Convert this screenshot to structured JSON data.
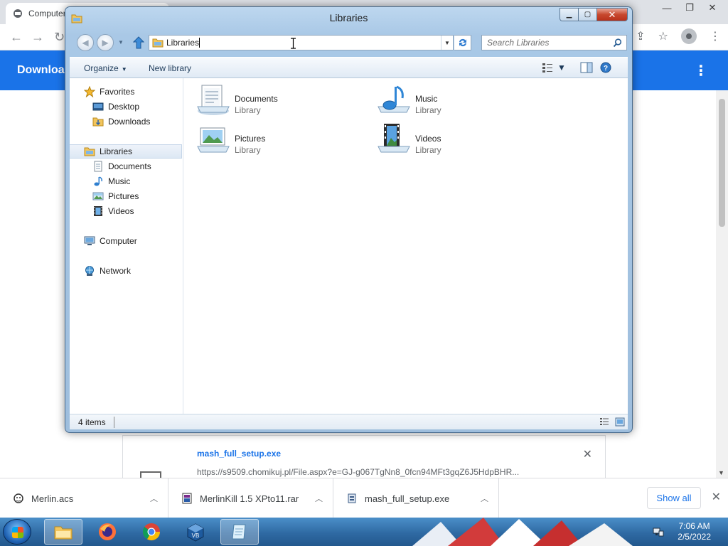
{
  "chrome": {
    "tab_title": "Computer",
    "header_title": "Downloads",
    "download_card": {
      "filename": "mash_full_setup.exe",
      "url": "https://s9509.chomikuj.pl/File.aspx?e=GJ-g067TgNn8_0fcn94MFt3gqZ6J5HdpBHR..."
    }
  },
  "explorer": {
    "title": "Libraries",
    "address_value": "Libraries",
    "search_placeholder": "Search Libraries",
    "toolbar": {
      "organize_label": "Organize",
      "new_library_label": "New library"
    },
    "nav_pane": {
      "favorites": {
        "label": "Favorites",
        "items": [
          "Desktop",
          "Downloads"
        ]
      },
      "libraries": {
        "label": "Libraries",
        "items": [
          "Documents",
          "Music",
          "Pictures",
          "Videos"
        ]
      },
      "computer_label": "Computer",
      "network_label": "Network"
    },
    "libraries": [
      {
        "name": "Documents",
        "type": "Library"
      },
      {
        "name": "Music",
        "type": "Library"
      },
      {
        "name": "Pictures",
        "type": "Library"
      },
      {
        "name": "Videos",
        "type": "Library"
      }
    ],
    "status_count": "4 items"
  },
  "download_shelf": {
    "items": [
      {
        "filename": "Merlin.acs"
      },
      {
        "filename": "MerlinKill 1.5 XPto11.rar"
      },
      {
        "filename": "mash_full_setup.exe"
      }
    ],
    "show_all_label": "Show all"
  },
  "taskbar": {
    "clock_time": "7:06 AM",
    "clock_date": "2/5/2022"
  },
  "colors": {
    "chrome_accent": "#1a73e8",
    "close_button": "#c7482e"
  }
}
